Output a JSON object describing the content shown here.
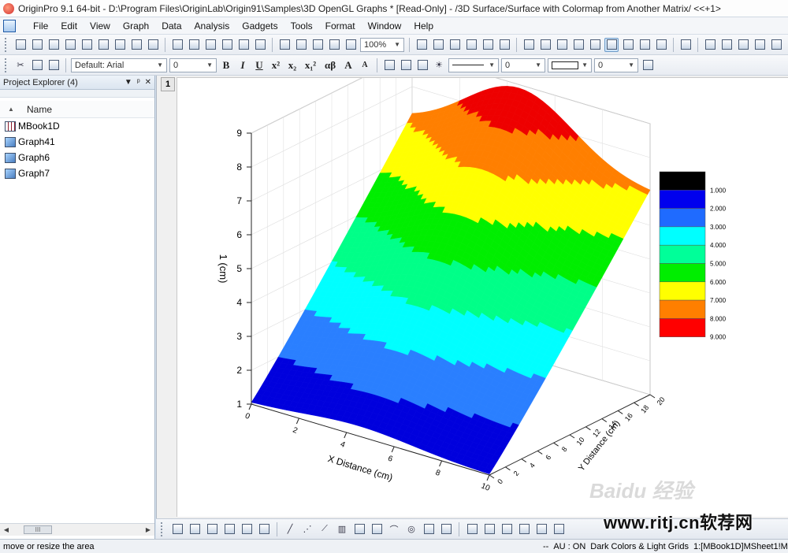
{
  "window": {
    "title": "OriginPro 9.1 64-bit - D:\\Program Files\\OriginLab\\Origin91\\Samples\\3D OpenGL Graphs * [Read-Only] - /3D Surface/Surface with Colormap from Another Matrix/ <<+1>"
  },
  "menu": [
    "File",
    "Edit",
    "View",
    "Graph",
    "Data",
    "Analysis",
    "Gadgets",
    "Tools",
    "Format",
    "Window",
    "Help"
  ],
  "toolbar": {
    "zoom": "100%",
    "font_name": "Default: Arial",
    "font_size": "0",
    "line_width": "0",
    "fill_value": "0",
    "format_buttons": [
      "B",
      "I",
      "U",
      "x²",
      "x₂",
      "x₁²",
      "αβ",
      "A",
      "A"
    ]
  },
  "explorer": {
    "title": "Project Explorer (4)",
    "column_name": "Name",
    "items": [
      {
        "label": "MBook1D",
        "icon": "workbook-icon"
      },
      {
        "label": "Graph41",
        "icon": "graph-icon"
      },
      {
        "label": "Graph6",
        "icon": "graph-icon"
      },
      {
        "label": "Graph7",
        "icon": "graph-icon"
      }
    ],
    "scroll_label": "III"
  },
  "graph": {
    "layer_label": "1",
    "z_axis_label": "1 (cm)",
    "x_axis_label": "X Distance (cm)",
    "y_axis_label": "Y Distance (cm)",
    "z_ticks": [
      "1",
      "2",
      "3",
      "4",
      "5",
      "6",
      "7",
      "8",
      "9"
    ],
    "x_ticks": [
      "0",
      "2",
      "4",
      "6",
      "8",
      "10"
    ],
    "y_ticks": [
      "0",
      "2",
      "4",
      "6",
      "8",
      "10",
      "12",
      "14",
      "16",
      "18",
      "20"
    ]
  },
  "chart_data": {
    "type": "surface",
    "title": "",
    "xlabel": "X Distance (cm)",
    "ylabel": "Y Distance (cm)",
    "zlabel": "1 (cm)",
    "xlim": [
      0,
      10
    ],
    "ylim": [
      0,
      20
    ],
    "zlim": [
      1,
      9
    ],
    "colormap_levels": [
      {
        "value": "1.000",
        "color": "#000000"
      },
      {
        "value": "2.000",
        "color": "#0000ee"
      },
      {
        "value": "3.000",
        "color": "#1f6bff"
      },
      {
        "value": "4.000",
        "color": "#00ffff"
      },
      {
        "value": "5.000",
        "color": "#00ff99"
      },
      {
        "value": "6.000",
        "color": "#00ee00"
      },
      {
        "value": "7.000",
        "color": "#ffff00"
      },
      {
        "value": "8.000",
        "color": "#ff7f00"
      },
      {
        "value": "9.000",
        "color": "#ff0000"
      }
    ],
    "band_colors": [
      "#0000dd",
      "#2a7fff",
      "#00ffff",
      "#00ff88",
      "#00ee00",
      "#ffff00",
      "#ff7f00",
      "#ee0000"
    ]
  },
  "status": {
    "left": "move or resize the area",
    "sep": "--",
    "au": "AU : ON",
    "theme": "Dark Colors & Light Grids",
    "sheet": "1:[MBook1D]MSheet1!M"
  },
  "watermark": {
    "site": "www.ritj.cn软荐网",
    "baidu": "Baidu 经验"
  }
}
